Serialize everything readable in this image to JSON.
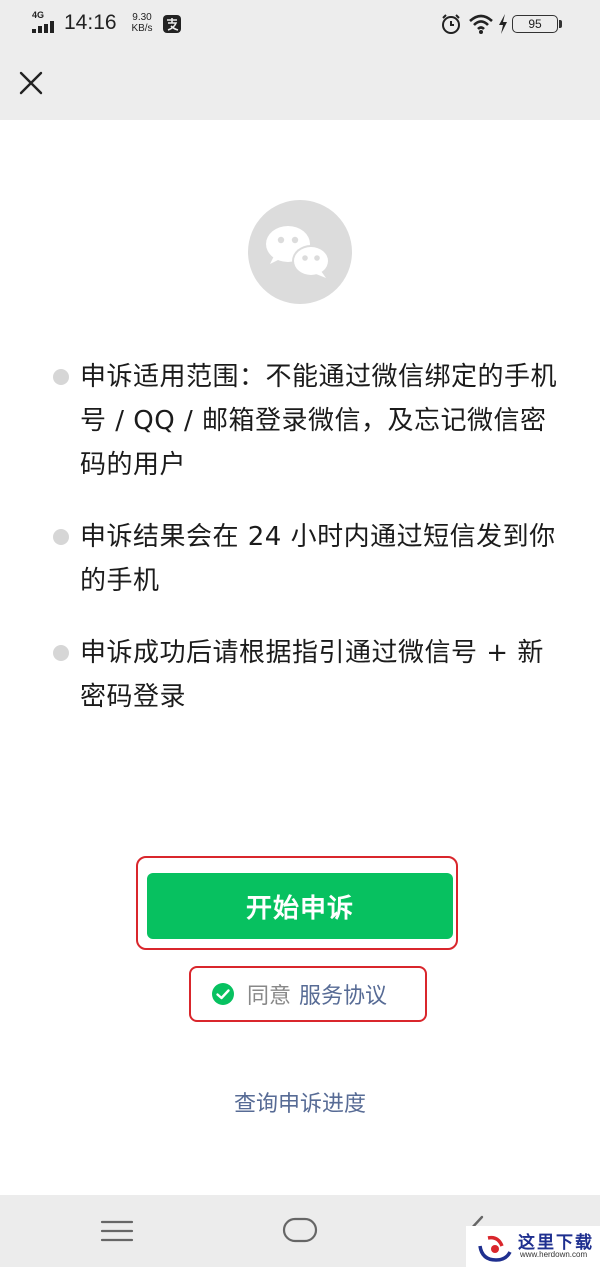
{
  "status_bar": {
    "network_type": "4G",
    "time": "14:16",
    "net_speed_value": "9.30",
    "net_speed_unit": "KB/s",
    "battery_level": "95",
    "icons": [
      "signal-icon",
      "alipay-icon",
      "alarm-icon",
      "wifi-icon",
      "charging-icon",
      "battery-icon"
    ]
  },
  "nav": {
    "close_icon": "close-icon"
  },
  "logo": {
    "icon": "wechat-logo-icon"
  },
  "rules": [
    "申诉适用范围：不能通过微信绑定的手机号 / QQ / 邮箱登录微信，及忘记微信密码的用户",
    "申诉结果会在 24 小时内通过短信发到你的手机",
    "申诉成功后请根据指引通过微信号 + 新密码登录"
  ],
  "actions": {
    "start_label": "开始申诉",
    "agree_text": "同意",
    "agreement_link": "服务协议",
    "agree_checked": true,
    "progress_link": "查询申诉进度"
  },
  "colors": {
    "primary_green": "#07c160",
    "link_blue": "#576b95",
    "highlight_red": "#d9262c",
    "header_gray": "#ededed"
  },
  "watermark": {
    "title": "这里下载",
    "url": "www.herdown.com"
  }
}
